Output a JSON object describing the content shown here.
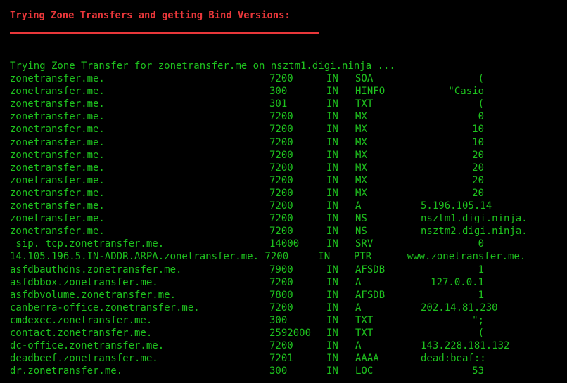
{
  "header": {
    "title": "Trying Zone Transfers and getting Bind Versions:",
    "rule_color": "#e8373a"
  },
  "colors": {
    "background": "#000000",
    "header": "#e8373a",
    "output": "#1ec21e"
  },
  "status_line": "Trying Zone Transfer for zonetransfer.me on nsztm1.digi.ninja ...",
  "records": [
    {
      "name": "zonetransfer.me.",
      "ttl": "7200",
      "cls": "IN",
      "type": "SOA",
      "value": "(",
      "align": "right"
    },
    {
      "name": "zonetransfer.me.",
      "ttl": "300",
      "cls": "IN",
      "type": "HINFO",
      "value": "\"Casio",
      "align": "right"
    },
    {
      "name": "zonetransfer.me.",
      "ttl": "301",
      "cls": "IN",
      "type": "TXT",
      "value": "(",
      "align": "right"
    },
    {
      "name": "zonetransfer.me.",
      "ttl": "7200",
      "cls": "IN",
      "type": "MX",
      "value": "0",
      "align": "right"
    },
    {
      "name": "zonetransfer.me.",
      "ttl": "7200",
      "cls": "IN",
      "type": "MX",
      "value": "10",
      "align": "right"
    },
    {
      "name": "zonetransfer.me.",
      "ttl": "7200",
      "cls": "IN",
      "type": "MX",
      "value": "10",
      "align": "right"
    },
    {
      "name": "zonetransfer.me.",
      "ttl": "7200",
      "cls": "IN",
      "type": "MX",
      "value": "20",
      "align": "right"
    },
    {
      "name": "zonetransfer.me.",
      "ttl": "7200",
      "cls": "IN",
      "type": "MX",
      "value": "20",
      "align": "right"
    },
    {
      "name": "zonetransfer.me.",
      "ttl": "7200",
      "cls": "IN",
      "type": "MX",
      "value": "20",
      "align": "right"
    },
    {
      "name": "zonetransfer.me.",
      "ttl": "7200",
      "cls": "IN",
      "type": "MX",
      "value": "20",
      "align": "right"
    },
    {
      "name": "zonetransfer.me.",
      "ttl": "7200",
      "cls": "IN",
      "type": "A",
      "value": "5.196.105.14",
      "align": "left"
    },
    {
      "name": "zonetransfer.me.",
      "ttl": "7200",
      "cls": "IN",
      "type": "NS",
      "value": "nsztm1.digi.ninja.",
      "align": "left"
    },
    {
      "name": "zonetransfer.me.",
      "ttl": "7200",
      "cls": "IN",
      "type": "NS",
      "value": "nsztm2.digi.ninja.",
      "align": "left"
    },
    {
      "name": "_sip._tcp.zonetransfer.me.",
      "ttl": "14000",
      "cls": "IN",
      "type": "SRV",
      "value": "0",
      "align": "right"
    },
    {
      "full": "14.105.196.5.IN-ADDR.ARPA.zonetransfer.me. 7200     IN    PTR      www.zonetransfer.me."
    },
    {
      "name": "asfdbauthdns.zonetransfer.me.",
      "ttl": "7900",
      "cls": "IN",
      "type": "AFSDB",
      "value": "1",
      "align": "right"
    },
    {
      "name": "asfdbbox.zonetransfer.me.",
      "ttl": "7200",
      "cls": "IN",
      "type": "A",
      "value": "127.0.0.1",
      "align": "right"
    },
    {
      "name": "asfdbvolume.zonetransfer.me.",
      "ttl": "7800",
      "cls": "IN",
      "type": "AFSDB",
      "value": "1",
      "align": "right"
    },
    {
      "name": "canberra-office.zonetransfer.me.",
      "ttl": "7200",
      "cls": "IN",
      "type": "A",
      "value": "202.14.81.230",
      "align": "left"
    },
    {
      "name": "cmdexec.zonetransfer.me.",
      "ttl": "300",
      "cls": "IN",
      "type": "TXT",
      "value": "\";",
      "align": "right"
    },
    {
      "name": "contact.zonetransfer.me.",
      "ttl": "2592000",
      "cls": "IN",
      "type": "TXT",
      "value": "(",
      "align": "right"
    },
    {
      "name": "dc-office.zonetransfer.me.",
      "ttl": "7200",
      "cls": "IN",
      "type": "A",
      "value": "143.228.181.132",
      "align": "left"
    },
    {
      "name": "deadbeef.zonetransfer.me.",
      "ttl": "7201",
      "cls": "IN",
      "type": "AAAA",
      "value": "dead:beaf::",
      "align": "left"
    },
    {
      "name": "dr.zonetransfer.me.",
      "ttl": "300",
      "cls": "IN",
      "type": "LOC",
      "value": "53",
      "align": "right"
    }
  ]
}
